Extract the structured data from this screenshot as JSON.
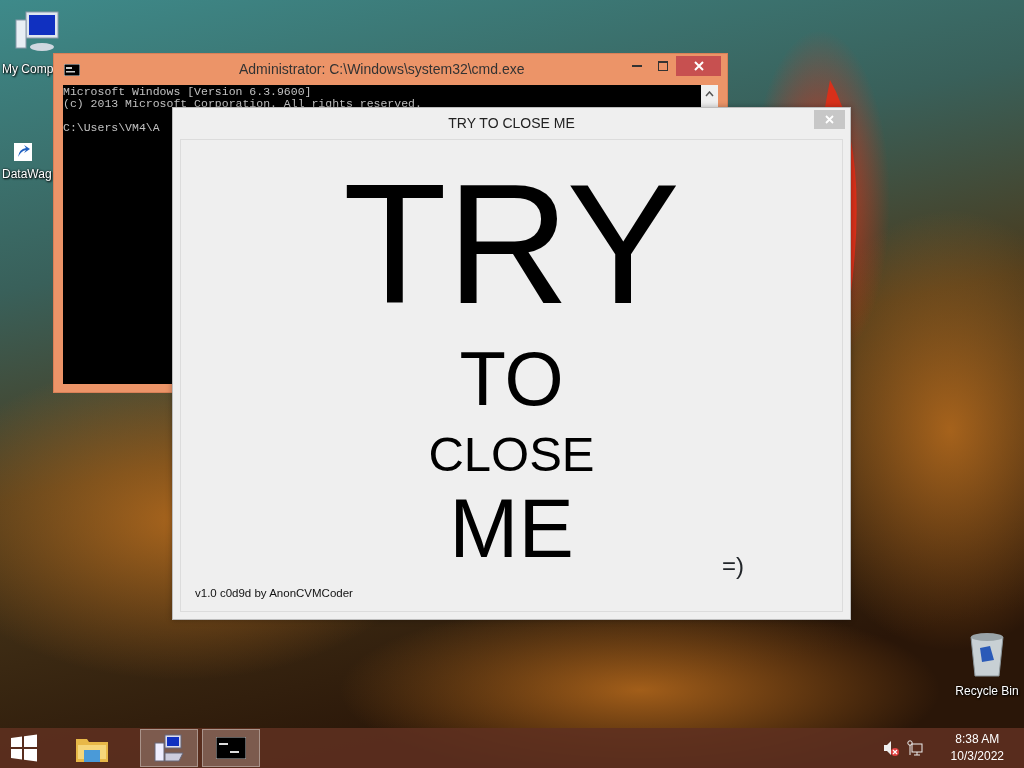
{
  "desktop_icons": [
    {
      "kind": "computer",
      "label": "My Comp"
    },
    {
      "kind": "shortcut",
      "label": "DataWag"
    },
    {
      "kind": "recycle",
      "label": "Recycle Bin"
    }
  ],
  "cmd_window": {
    "title": "Administrator: C:\\Windows\\system32\\cmd.exe",
    "lines": [
      "Microsoft Windows [Version 6.3.9600]",
      "(c) 2013 Microsoft Corporation. All rights reserved.",
      "C:\\Users\\VM4\\A"
    ]
  },
  "dialog": {
    "title": "TRY TO CLOSE ME",
    "words": [
      "TRY",
      "TO",
      "CLOSE",
      "ME"
    ],
    "smiley": "=)",
    "version": "v1.0 c0d9d by AnonCVMCoder"
  },
  "taskbar": {
    "items": [
      {
        "kind": "start",
        "active": false
      },
      {
        "kind": "explorer",
        "active": false
      },
      {
        "kind": "app",
        "active": true
      },
      {
        "kind": "cmd",
        "active": true
      }
    ],
    "volume_muted": true,
    "time": "8:38 AM",
    "date": "10/3/2022"
  }
}
